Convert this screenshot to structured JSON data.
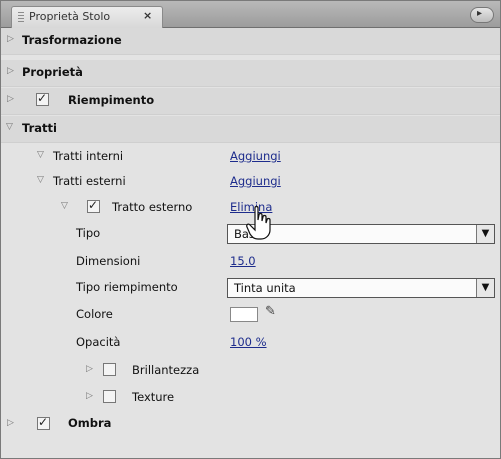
{
  "panel": {
    "tab_title": "Proprietà Stolo",
    "close_glyph": "×",
    "menu_glyph": "▸"
  },
  "sections": {
    "trasformazione": "Trasformazione",
    "proprieta": "Proprietà",
    "riempimento": "Riempimento",
    "tratti": "Tratti",
    "ombra": "Ombra"
  },
  "tratti": {
    "interni_label": "Tratti interni",
    "interni_action": "Aggiungi",
    "esterni_label": "Tratti esterni",
    "esterni_action": "Aggiungi",
    "esterno_label": "Tratto esterno",
    "esterno_action": "Elimina"
  },
  "props": {
    "tipo_label": "Tipo",
    "tipo_value": "Base",
    "dimensioni_label": "Dimensioni",
    "dimensioni_value": "15.0",
    "tipo_riempimento_label": "Tipo riempimento",
    "tipo_riempimento_value": "Tinta unita",
    "colore_label": "Colore",
    "colore_value": "#ffffff",
    "opacita_label": "Opacità",
    "opacita_value": "100 %",
    "brillantezza_label": "Brillantezza",
    "texture_label": "Texture"
  },
  "checkboxes": {
    "riempimento": true,
    "tratto_esterno": true,
    "brillantezza": false,
    "texture": false,
    "ombra": true
  },
  "icons": {
    "expand": "▷",
    "collapse": "▽",
    "dropdown": "▼",
    "eyedropper": "✎"
  }
}
